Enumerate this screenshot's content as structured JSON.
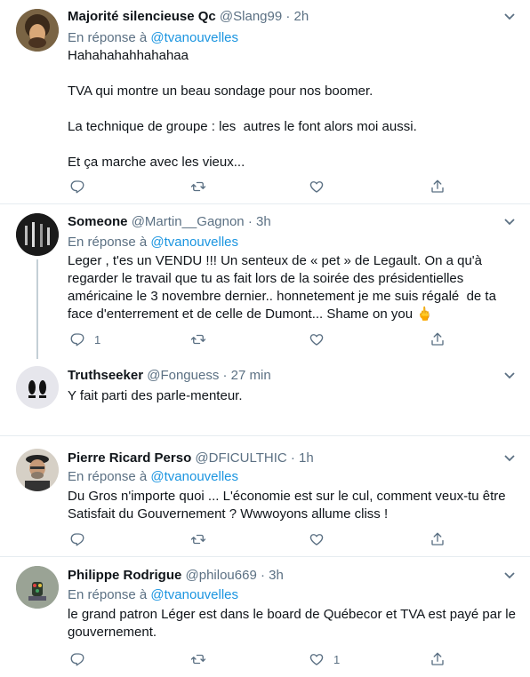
{
  "tweets": [
    {
      "name": "Majorité silencieuse Qc",
      "handle": "@Slang99",
      "time": "2h",
      "reply_prefix": "En réponse à ",
      "reply_to": "@tvanouvelles",
      "text": "Hahahahahhahahaa\n\nTVA qui montre un beau sondage pour nos boomer.\n\nLa technique de groupe : les  autres le font alors moi aussi.\n\nEt ça marche avec les vieux...",
      "reply_count": "",
      "like_count": ""
    },
    {
      "name": "Someone",
      "handle": "@Martin__Gagnon",
      "time": "3h",
      "reply_prefix": "En réponse à ",
      "reply_to": "@tvanouvelles",
      "text": "Leger , t'es un VENDU !!! Un senteux de « pet » de Legault. On a qu'à regarder le travail que tu as fait lors de la soirée des présidentielles américaine le 3 novembre dernier.. honnetement je me suis régalé  de ta face d'enterrement et de celle de Dumont... Shame on you 🖕",
      "reply_count": "1",
      "like_count": ""
    },
    {
      "name": "Truthseeker",
      "handle": "@Fonguess",
      "time": "27 min",
      "text": "Y fait parti des parle-menteur.",
      "reply_count": "",
      "like_count": ""
    },
    {
      "name": "Pierre Ricard Perso",
      "handle": "@DFICULTHIC",
      "time": "1h",
      "reply_prefix": "En réponse à ",
      "reply_to": "@tvanouvelles",
      "text": "Du Gros n'importe quoi ... L'économie est sur le cul, comment veux-tu être Satisfait du Gouvernement ? Wwwoyons allume cliss !",
      "reply_count": "",
      "like_count": ""
    },
    {
      "name": "Philippe Rodrigue",
      "handle": "@philou669",
      "time": "3h",
      "reply_prefix": "En réponse à ",
      "reply_to": "@tvanouvelles",
      "text": "le grand patron Léger est dans le board de Québecor et TVA est payé par le gouvernement.",
      "reply_count": "",
      "like_count": "1"
    }
  ],
  "dot": "·",
  "colors": {
    "link": "#1b95e0",
    "muted": "#5b7083",
    "separator": "#e6ecf0"
  },
  "icons": [
    "reply-icon",
    "retweet-icon",
    "like-icon",
    "share-icon",
    "chevron-down-icon"
  ]
}
